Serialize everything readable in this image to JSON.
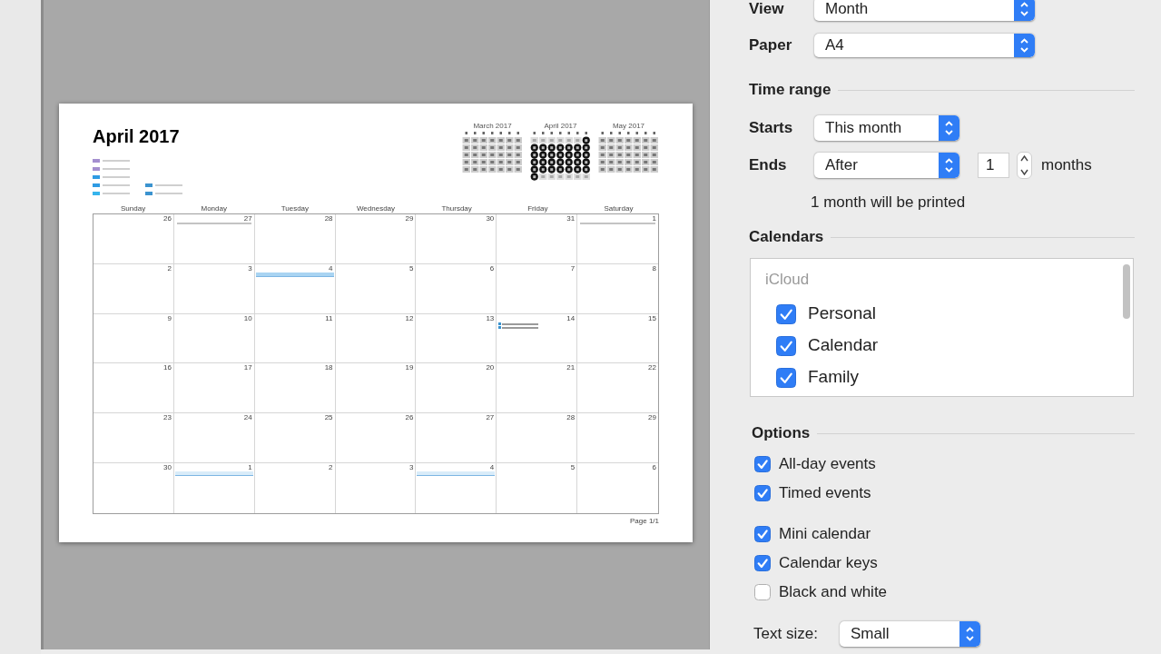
{
  "preview": {
    "title": "April 2017",
    "calendar_keys": {
      "column_1": [
        {
          "color": "#a48fcf"
        },
        {
          "color": "#a48fcf"
        },
        {
          "color": "#2f9be3"
        },
        {
          "color": "#2f9be3"
        },
        {
          "color": "#35b4ec"
        }
      ],
      "column_2": [
        {
          "color": "#3b93cf"
        },
        {
          "color": "#3b93cf"
        }
      ]
    },
    "mini_calendars": [
      {
        "title": "March 2017",
        "highlighted": false
      },
      {
        "title": "April 2017",
        "highlighted": true
      },
      {
        "title": "May 2017",
        "highlighted": false
      }
    ],
    "weekdays": [
      "Sunday",
      "Monday",
      "Tuesday",
      "Wednesday",
      "Thursday",
      "Friday",
      "Saturday"
    ],
    "weeks": [
      {
        "days": [
          {
            "number": "26"
          },
          {
            "number": "27",
            "events": [
              {
                "kind": "plain"
              }
            ]
          },
          {
            "number": "28"
          },
          {
            "number": "29"
          },
          {
            "number": "30"
          },
          {
            "number": "31"
          },
          {
            "number": "1",
            "events": [
              {
                "kind": "plain"
              }
            ]
          }
        ]
      },
      {
        "days": [
          {
            "number": "2"
          },
          {
            "number": "3"
          },
          {
            "number": "4",
            "events": [
              {
                "kind": "all_day",
                "color": "#a9d4f2"
              }
            ]
          },
          {
            "number": "5"
          },
          {
            "number": "6"
          },
          {
            "number": "7"
          },
          {
            "number": "8"
          }
        ]
      },
      {
        "days": [
          {
            "number": "9"
          },
          {
            "number": "10"
          },
          {
            "number": "11"
          },
          {
            "number": "12"
          },
          {
            "number": "13"
          },
          {
            "number": "14",
            "events": [
              {
                "kind": "timed",
                "color": "#3b93cf"
              },
              {
                "kind": "timed",
                "color": "#3b93cf"
              }
            ]
          },
          {
            "number": "15"
          }
        ]
      },
      {
        "days": [
          {
            "number": "16"
          },
          {
            "number": "17"
          },
          {
            "number": "18"
          },
          {
            "number": "19"
          },
          {
            "number": "20"
          },
          {
            "number": "21"
          },
          {
            "number": "22"
          }
        ]
      },
      {
        "days": [
          {
            "number": "23"
          },
          {
            "number": "24"
          },
          {
            "number": "25"
          },
          {
            "number": "26"
          },
          {
            "number": "27"
          },
          {
            "number": "28"
          },
          {
            "number": "29"
          }
        ]
      },
      {
        "days": [
          {
            "number": "30"
          },
          {
            "number": "1",
            "events": [
              {
                "kind": "all_day",
                "color": "#d9ecf9"
              }
            ]
          },
          {
            "number": "2"
          },
          {
            "number": "3"
          },
          {
            "number": "4",
            "events": [
              {
                "kind": "all_day",
                "color": "#d9ecf9"
              }
            ]
          },
          {
            "number": "5"
          },
          {
            "number": "6"
          }
        ]
      }
    ],
    "footer": "Page 1/1"
  },
  "settings": {
    "view": {
      "label": "View",
      "value": "Month"
    },
    "paper": {
      "label": "Paper",
      "value": "A4"
    },
    "time_range": {
      "heading": "Time range",
      "starts": {
        "label": "Starts",
        "value": "This month"
      },
      "ends": {
        "label": "Ends",
        "value": "After",
        "count": "1",
        "unit": "months"
      },
      "summary": "1 month will be printed"
    },
    "calendars": {
      "heading": "Calendars",
      "group": "iCloud",
      "items": [
        {
          "label": "Personal",
          "checked": true
        },
        {
          "label": "Calendar",
          "checked": true
        },
        {
          "label": "Family",
          "checked": true
        }
      ]
    },
    "options": {
      "heading": "Options",
      "groups": [
        {
          "items": [
            {
              "label": "All-day events",
              "checked": true
            },
            {
              "label": "Timed events",
              "checked": true
            }
          ]
        },
        {
          "items": [
            {
              "label": "Mini calendar",
              "checked": true
            },
            {
              "label": "Calendar keys",
              "checked": true
            },
            {
              "label": "Black and white",
              "checked": false
            }
          ]
        }
      ]
    },
    "text_size": {
      "label": "Text size:",
      "value": "Small"
    }
  }
}
